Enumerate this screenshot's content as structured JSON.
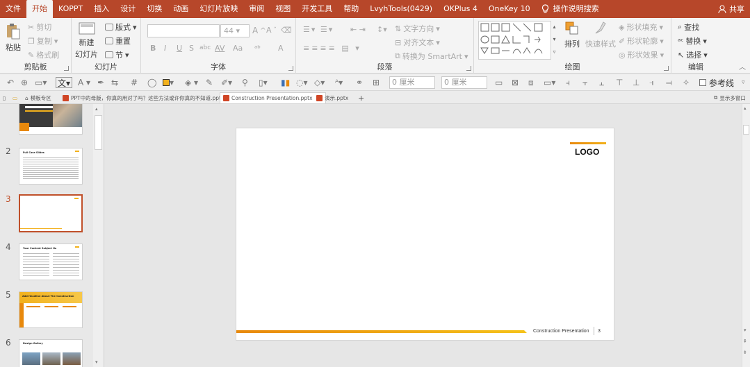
{
  "menu": {
    "items": [
      "文件",
      "开始",
      "KOPPT",
      "插入",
      "设计",
      "切换",
      "动画",
      "幻灯片放映",
      "审阅",
      "视图",
      "开发工具",
      "帮助",
      "LvyhTools(0429)",
      "OKPlus 4",
      "OneKey 10"
    ],
    "tell_me": "操作说明搜索",
    "share": "共享"
  },
  "ribbon": {
    "clipboard": {
      "paste": "粘贴",
      "cut": "剪切",
      "copy": "复制",
      "format_painter": "格式刷",
      "label": "剪贴板"
    },
    "slides": {
      "new_slide": "新建",
      "new_slide2": "幻灯片",
      "layout": "版式",
      "reset": "重置",
      "section": "节",
      "label": "幻灯片"
    },
    "font": {
      "size": "44",
      "bold": "B",
      "italic": "I",
      "underline": "U",
      "strike": "S",
      "shadow": "abc",
      "spacing": "AV",
      "case": "Aa",
      "color": "A",
      "label": "字体"
    },
    "paragraph": {
      "text_direction": "文字方向",
      "align_text": "对齐文本",
      "smartart": "转换为 SmartArt",
      "label": "段落"
    },
    "drawing": {
      "arrange": "排列",
      "quick_styles": "快速样式",
      "fill": "形状填充",
      "outline": "形状轮廓",
      "effects": "形状效果",
      "label": "绘图"
    },
    "editing": {
      "find": "查找",
      "replace": "替换",
      "select": "选择",
      "label": "编辑"
    }
  },
  "qat": {
    "width_value": "0 厘米",
    "height_value": "0 厘米",
    "guides": "参考线"
  },
  "doc_tabs": {
    "templates": "模板专区",
    "tabs": [
      "PPT中的母版，你真的用对了吗？这些方法或许你真的不知道.pptx",
      "Construction Presentation.pptx",
      "演示.pptx"
    ],
    "multi_window": "显示多窗口"
  },
  "thumbnails": {
    "numbers": [
      "2",
      "3",
      "4",
      "5",
      "6"
    ],
    "s2_title": "Full Case Slides",
    "s4_title": "Your Content Subject Ha",
    "s5_title": "Add Headline About The Construction",
    "s6_title": "Design Gallery"
  },
  "slide": {
    "logo": "LOGO",
    "footer": "Construction Presentation",
    "page": "3"
  },
  "colors": {
    "accent": "#b7472a",
    "gold": "#f2b11c",
    "orange": "#e8890c"
  }
}
